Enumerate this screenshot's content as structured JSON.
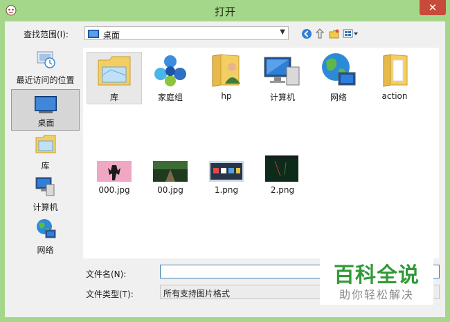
{
  "window": {
    "title": "打开",
    "close_label": "✕"
  },
  "look_in": {
    "label": "查找范围(I):",
    "value": "桌面"
  },
  "places": [
    {
      "label": "最近访问的位置",
      "icon": "recent-places-icon"
    },
    {
      "label": "桌面",
      "icon": "desktop-icon",
      "selected": true
    },
    {
      "label": "库",
      "icon": "library-icon"
    },
    {
      "label": "计算机",
      "icon": "computer-icon"
    },
    {
      "label": "网络",
      "icon": "network-icon"
    }
  ],
  "files": [
    {
      "label": "库",
      "icon": "library-folder-icon",
      "selected": true
    },
    {
      "label": "家庭组",
      "icon": "homegroup-icon"
    },
    {
      "label": "hp",
      "icon": "user-folder-icon"
    },
    {
      "label": "计算机",
      "icon": "computer-icon"
    },
    {
      "label": "网络",
      "icon": "network-icon"
    },
    {
      "label": "action",
      "icon": "folder-icon"
    },
    {
      "label": "000.jpg",
      "icon": "image-thumbnail-icon"
    },
    {
      "label": "00.jpg",
      "icon": "image-thumbnail-icon"
    },
    {
      "label": "1.png",
      "icon": "image-thumbnail-icon"
    },
    {
      "label": "2.png",
      "icon": "image-thumbnail-icon"
    }
  ],
  "file_name": {
    "label": "文件名(N):",
    "value": ""
  },
  "file_type": {
    "label": "文件类型(T):",
    "value": "所有支持图片格式"
  },
  "watermark": {
    "title": "百科全说",
    "subtitle": "助你轻松解决"
  }
}
